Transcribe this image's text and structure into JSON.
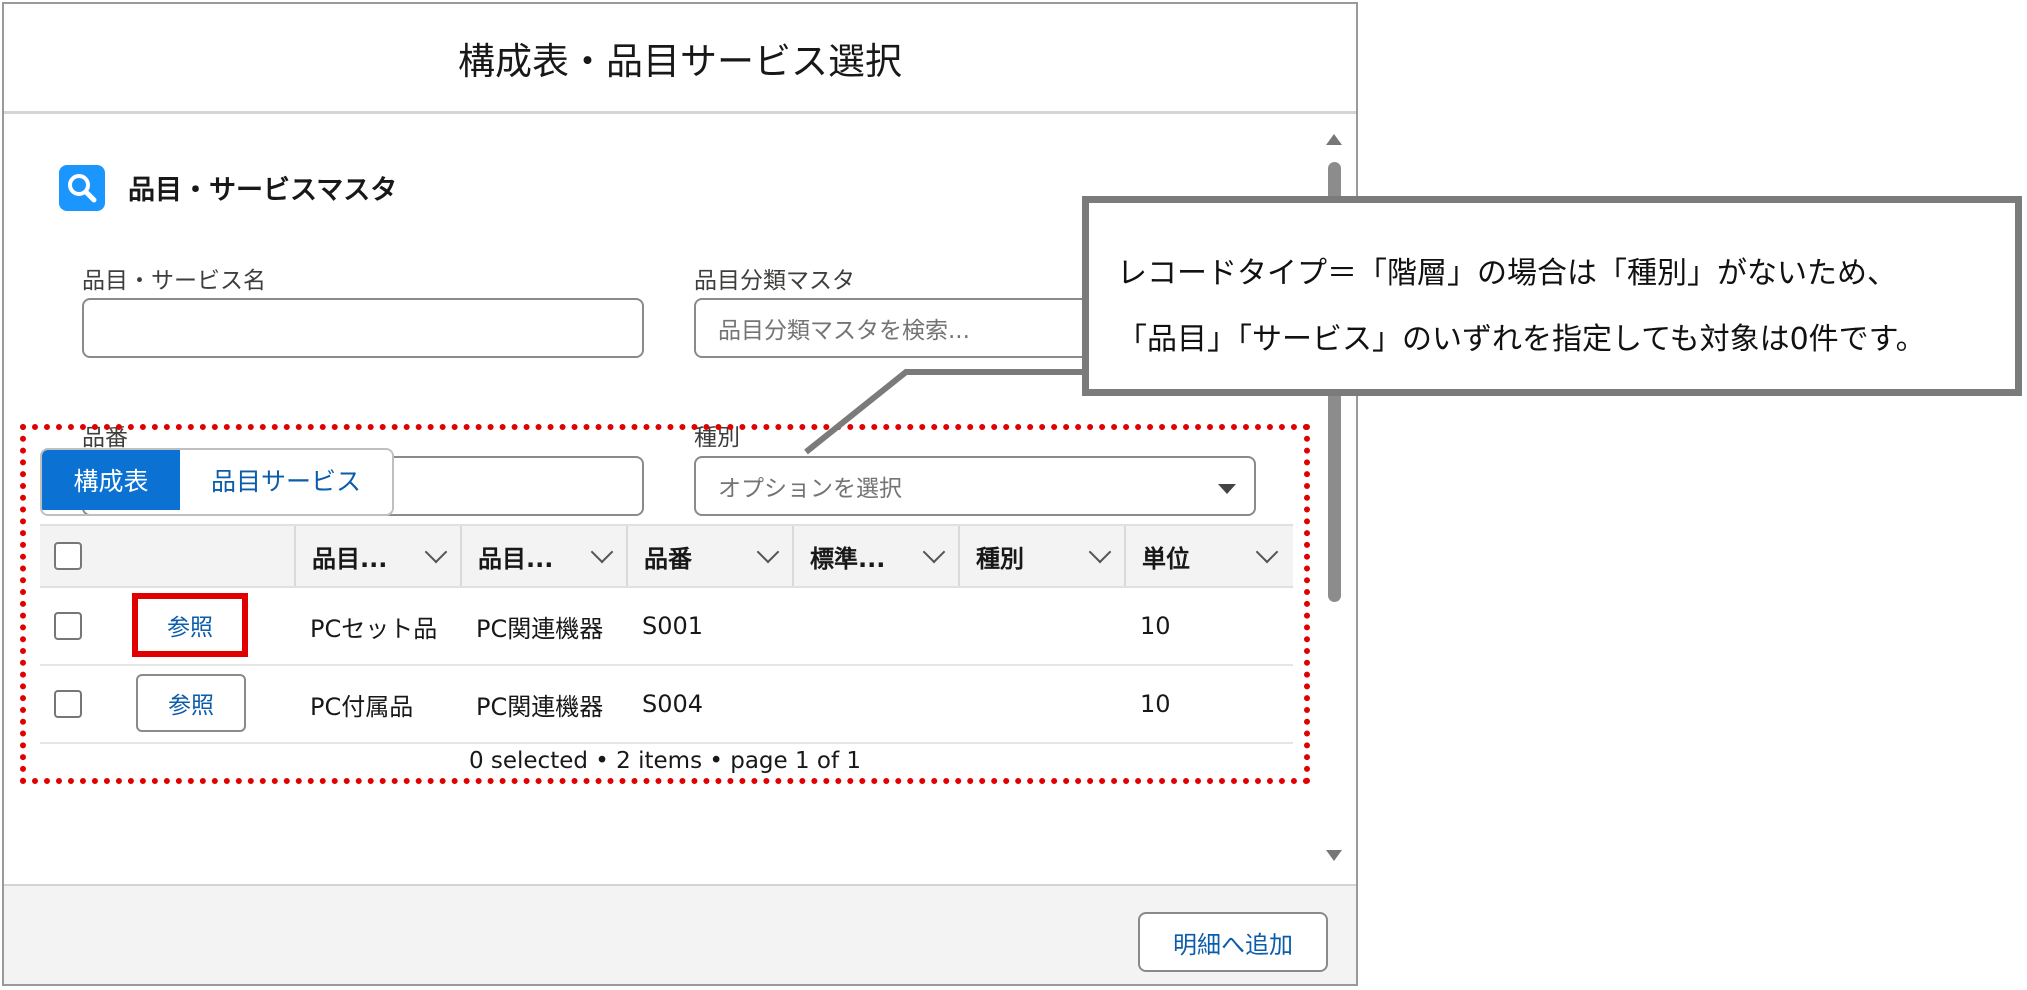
{
  "modal": {
    "title": "構成表・品目サービス選択"
  },
  "section": {
    "title": "品目・サービスマスタ",
    "icon": "search-icon"
  },
  "fields": {
    "item_name": {
      "label": "品目・サービス名",
      "value": ""
    },
    "category": {
      "label": "品目分類マスタ",
      "placeholder": "品目分類マスタを検索..."
    },
    "item_no": {
      "label": "品番",
      "value": ""
    },
    "type": {
      "label": "種別",
      "placeholder": "オプションを選択"
    }
  },
  "tabs": [
    {
      "label": "構成表",
      "active": true
    },
    {
      "label": "品目サービス",
      "active": false
    }
  ],
  "table": {
    "columns": [
      "品目...",
      "品目...",
      "品番",
      "標準...",
      "種別",
      "単位"
    ],
    "rows": [
      {
        "action": "参照",
        "c1": "PCセット品",
        "c2": "PC関連機器",
        "c3": "S001",
        "c4": "",
        "c5": "",
        "c6": "10"
      },
      {
        "action": "参照",
        "c1": "PC付属品",
        "c2": "PC関連機器",
        "c3": "S004",
        "c4": "",
        "c5": "",
        "c6": "10"
      }
    ],
    "footer": "0 selected • 2 items • page 1 of 1"
  },
  "footer": {
    "add_label": "明細へ追加"
  },
  "callout": {
    "line1": "レコードタイプ＝「階層」の場合は「種別」がないため、",
    "line2": "「品目」「サービス」のいずれを指定しても対象は0件です。"
  },
  "colors": {
    "accent": "#0b72d4",
    "highlight": "#e00000",
    "icon_bg": "#1b96ff"
  }
}
